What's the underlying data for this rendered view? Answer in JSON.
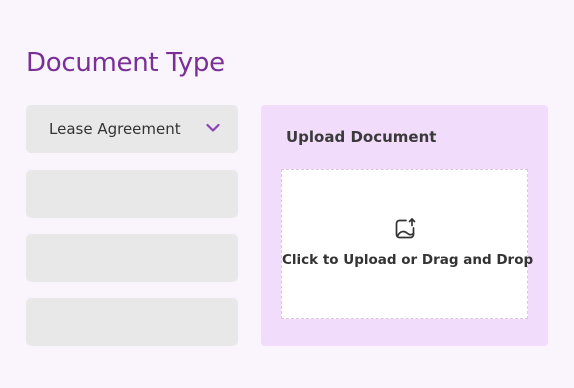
{
  "title": "Document Type",
  "document_type": {
    "selected": "Lease Agreement",
    "icon": "chevron-down-icon",
    "chevron_color": "#8d44b8"
  },
  "upload": {
    "heading": "Upload Document",
    "prompt": "Click to Upload or Drag and Drop",
    "icon": "image-upload-icon"
  },
  "colors": {
    "title": "#7a2f96",
    "panel": "#f2dcfb",
    "field": "#e8e8e8",
    "background": "#faf5fc"
  }
}
